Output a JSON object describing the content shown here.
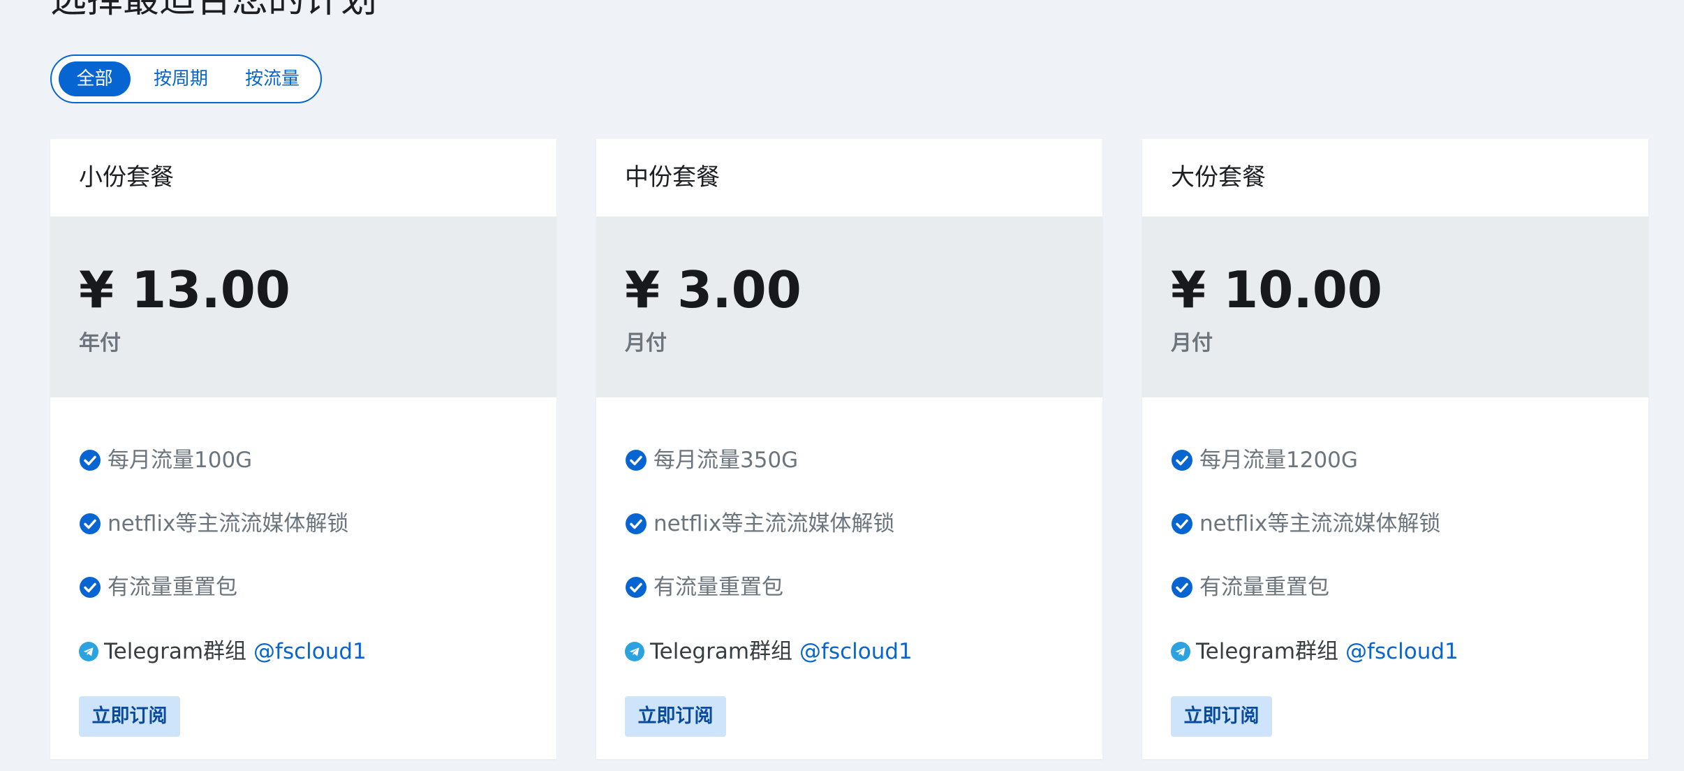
{
  "page": {
    "title": "选择最适合您的计划"
  },
  "filters": {
    "all": "全部",
    "by_period": "按周期",
    "by_traffic": "按流量",
    "selected": "全部"
  },
  "colors": {
    "accent": "#0665d0",
    "background": "#eff3f8",
    "price_block": "#e9ecef",
    "subscribe_button_bg": "#cde4fb",
    "telegram_blue": "#2aa3e0"
  },
  "plans": [
    {
      "name": "小份套餐",
      "price": "¥ 13.00",
      "period": "年付",
      "features": [
        "每月流量100G",
        "netflix等主流流媒体解锁",
        "有流量重置包"
      ],
      "telegram_label": "Telegram群组",
      "telegram_handle": "@fscloud1",
      "subscribe_label": "立即订阅"
    },
    {
      "name": "中份套餐",
      "price": "¥ 3.00",
      "period": "月付",
      "features": [
        "每月流量350G",
        "netflix等主流流媒体解锁",
        "有流量重置包"
      ],
      "telegram_label": "Telegram群组",
      "telegram_handle": "@fscloud1",
      "subscribe_label": "立即订阅"
    },
    {
      "name": "大份套餐",
      "price": "¥ 10.00",
      "period": "月付",
      "features": [
        "每月流量1200G",
        "netflix等主流流媒体解锁",
        "有流量重置包"
      ],
      "telegram_label": "Telegram群组",
      "telegram_handle": "@fscloud1",
      "subscribe_label": "立即订阅"
    }
  ],
  "icons": {
    "feature": "check-circle-icon",
    "telegram": "telegram-icon"
  }
}
